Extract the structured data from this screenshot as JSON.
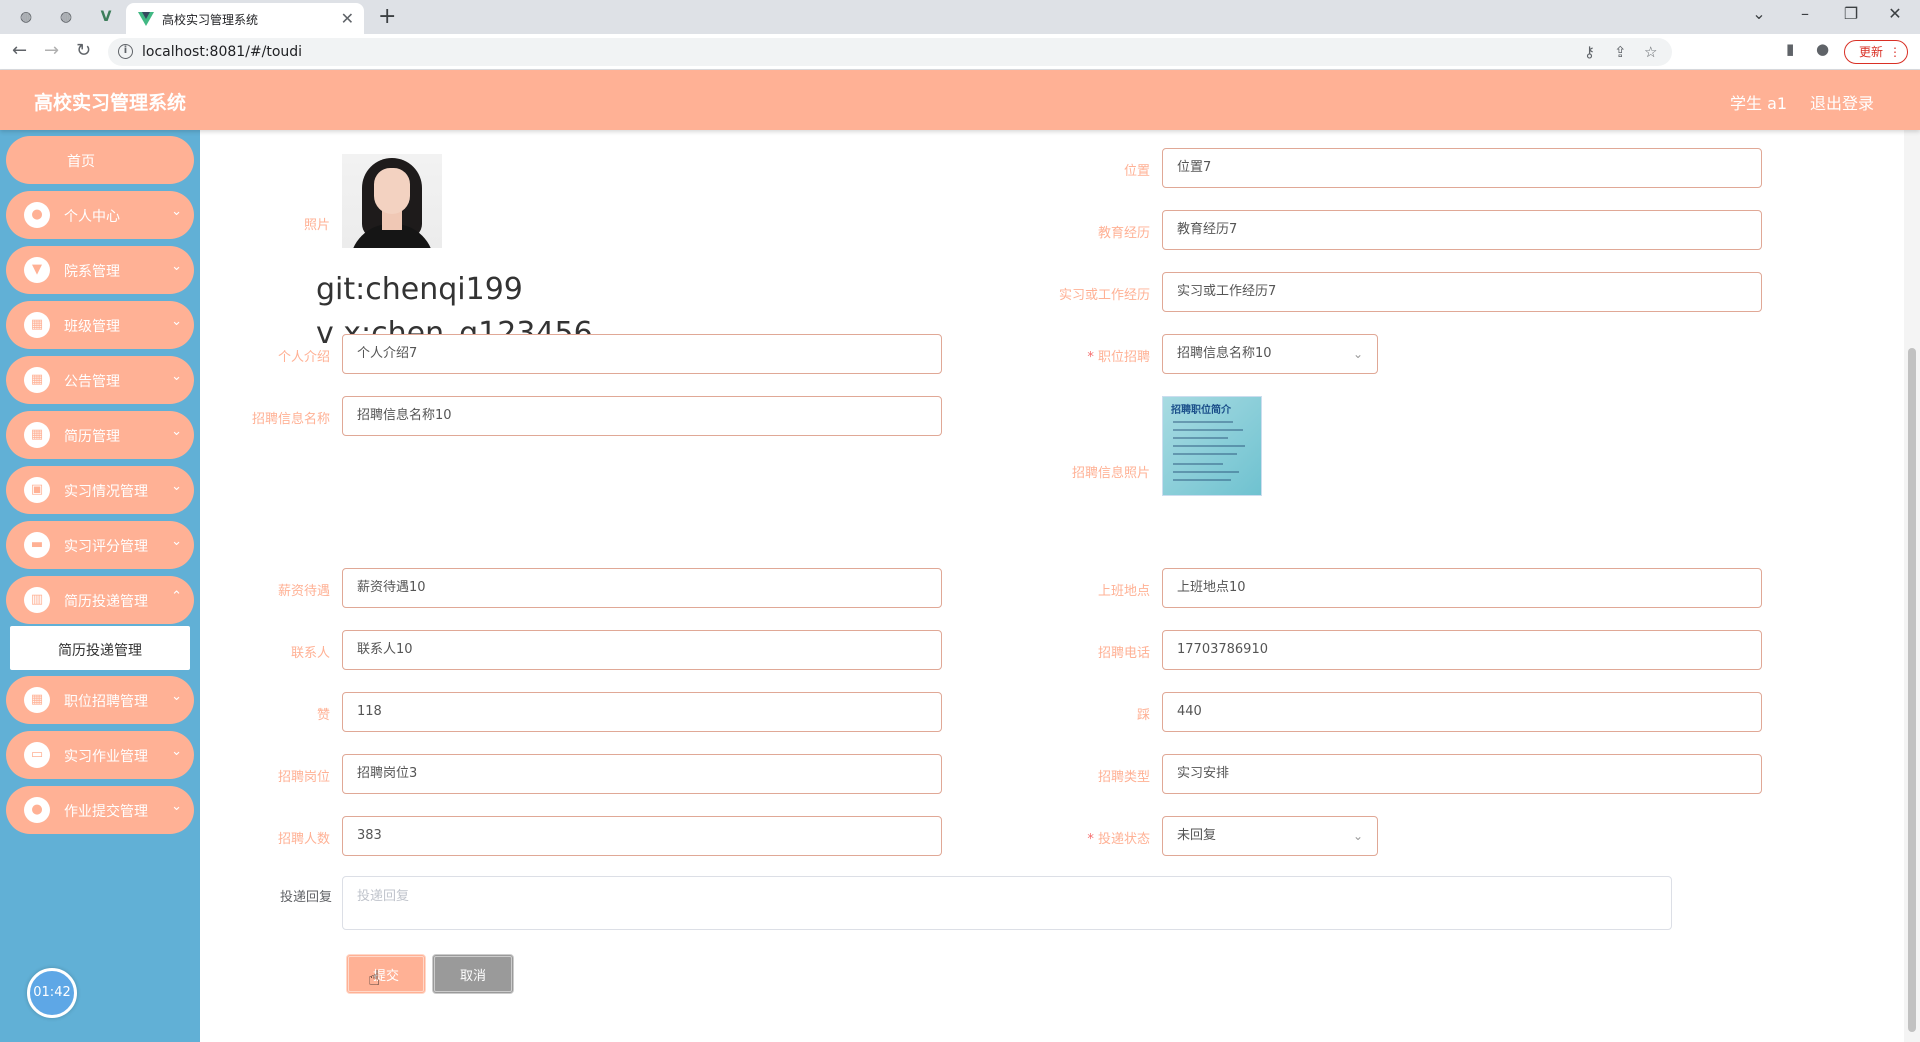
{
  "browser": {
    "tab_title": "高校实习管理系统",
    "url": "localhost:8081/#/toudi",
    "update_label": "更新"
  },
  "header": {
    "title": "高校实习管理系统",
    "user": "学生 a1",
    "logout": "退出登录"
  },
  "sidebar": {
    "items": [
      {
        "label": "首页",
        "icon": "home"
      },
      {
        "label": "个人中心",
        "icon": "user-icon"
      },
      {
        "label": "院系管理",
        "icon": "building-icon"
      },
      {
        "label": "班级管理",
        "icon": "grid-icon"
      },
      {
        "label": "公告管理",
        "icon": "grid-icon"
      },
      {
        "label": "简历管理",
        "icon": "grid-icon"
      },
      {
        "label": "实习情况管理",
        "icon": "clipboard-icon"
      },
      {
        "label": "实习评分管理",
        "icon": "briefcase-icon"
      },
      {
        "label": "简历投递管理",
        "icon": "chart-icon"
      },
      {
        "label": "职位招聘管理",
        "icon": "grid-icon"
      },
      {
        "label": "实习作业管理",
        "icon": "ticket-icon"
      },
      {
        "label": "作业提交管理",
        "icon": "user-icon"
      }
    ],
    "active_sub": "简历投递管理",
    "timer": "01:42"
  },
  "watermark": {
    "line1": "git:chenqi199",
    "line2": "v x:chen_q123456"
  },
  "form": {
    "photo_label": "照片",
    "location": {
      "label": "位置",
      "value": "位置7"
    },
    "education": {
      "label": "教育经历",
      "value": "教育经历7"
    },
    "experience": {
      "label": "实习或工作经历",
      "value": "实习或工作经历7"
    },
    "intro": {
      "label": "个人介绍",
      "value": "个人介绍7"
    },
    "job_select": {
      "label": "职位招聘",
      "value": "招聘信息名称10"
    },
    "info_name": {
      "label": "招聘信息名称",
      "value": "招聘信息名称10"
    },
    "info_photo": {
      "label": "招聘信息照片",
      "image_title": "招聘职位简介"
    },
    "salary": {
      "label": "薪资待遇",
      "value": "薪资待遇10"
    },
    "work_place": {
      "label": "上班地点",
      "value": "上班地点10"
    },
    "contact": {
      "label": "联系人",
      "value": "联系人10"
    },
    "phone": {
      "label": "招聘电话",
      "value": "17703786910"
    },
    "likes": {
      "label": "赞",
      "value": "118"
    },
    "dislikes": {
      "label": "踩",
      "value": "440"
    },
    "position": {
      "label": "招聘岗位",
      "value": "招聘岗位3"
    },
    "type": {
      "label": "招聘类型",
      "value": "实习安排"
    },
    "count": {
      "label": "招聘人数",
      "value": "383"
    },
    "status": {
      "label": "投递状态",
      "value": "未回复"
    },
    "reply": {
      "label": "投递回复",
      "placeholder": "投递回复"
    },
    "submit": "提交",
    "cancel": "取消"
  }
}
